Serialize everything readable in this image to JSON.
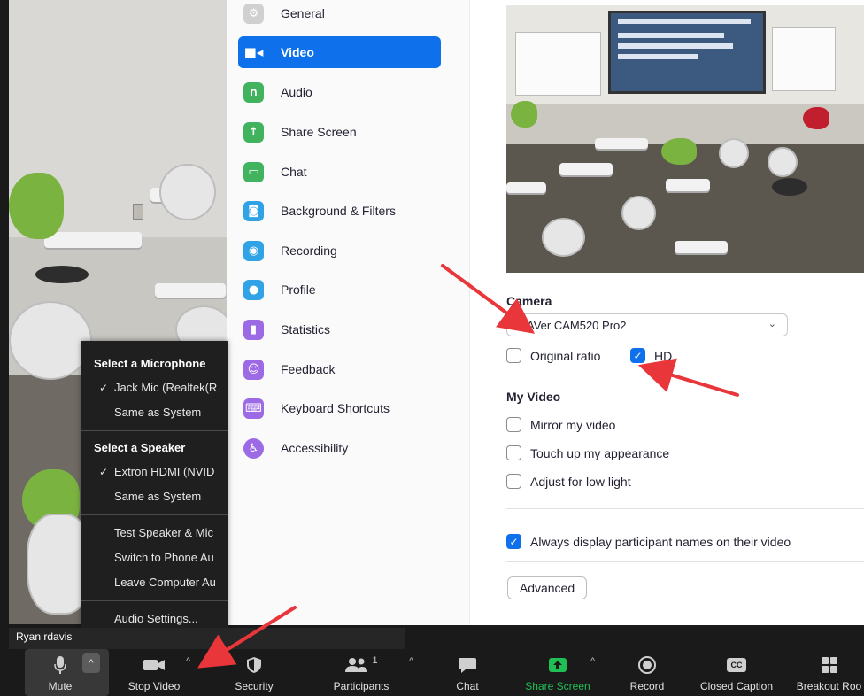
{
  "settings_nav": {
    "items": [
      {
        "label": "General",
        "icon": "gear-icon",
        "color": "#d0d0d0"
      },
      {
        "label": "Video",
        "icon": "video-camera-icon",
        "color": "#0e71eb",
        "active": true
      },
      {
        "label": "Audio",
        "icon": "headphones-icon",
        "color": "#41b35f"
      },
      {
        "label": "Share Screen",
        "icon": "share-screen-icon",
        "color": "#41b35f"
      },
      {
        "label": "Chat",
        "icon": "chat-bubble-icon",
        "color": "#41b35f"
      },
      {
        "label": "Background & Filters",
        "icon": "background-icon",
        "color": "#2fa3e6"
      },
      {
        "label": "Recording",
        "icon": "record-icon",
        "color": "#2fa3e6"
      },
      {
        "label": "Profile",
        "icon": "person-icon",
        "color": "#2fa3e6"
      },
      {
        "label": "Statistics",
        "icon": "bar-chart-icon",
        "color": "#9d6ae6"
      },
      {
        "label": "Feedback",
        "icon": "smiley-icon",
        "color": "#9d6ae6"
      },
      {
        "label": "Keyboard Shortcuts",
        "icon": "keyboard-icon",
        "color": "#9d6ae6"
      },
      {
        "label": "Accessibility",
        "icon": "accessibility-icon",
        "color": "#9d6ae6"
      }
    ]
  },
  "video_settings": {
    "camera_label": "Camera",
    "camera_value": "AVer CAM520 Pro2",
    "original_ratio_label": "Original ratio",
    "original_ratio_checked": false,
    "hd_label": "HD",
    "hd_checked": true,
    "my_video_label": "My Video",
    "mirror_label": "Mirror my video",
    "touch_up_label": "Touch up my appearance",
    "low_light_label": "Adjust for low light",
    "always_display_label": "Always display participant names on their video",
    "advanced_label": "Advanced"
  },
  "audio_menu": {
    "mic_title": "Select a Microphone",
    "mic_items": [
      "Jack Mic (Realtek(R",
      "Same as System"
    ],
    "speaker_title": "Select a Speaker",
    "speaker_items": [
      "Extron HDMI (NVID",
      "Same as System"
    ],
    "actions": [
      "Test Speaker & Mic",
      "Switch to Phone Au",
      "Leave Computer Au"
    ],
    "settings": "Audio Settings..."
  },
  "name_tag": "Ryan rdavis",
  "toolbar": {
    "mute": "Mute",
    "stop_video": "Stop Video",
    "security": "Security",
    "participants": "Participants",
    "participants_count": "1",
    "chat": "Chat",
    "share_screen": "Share Screen",
    "record": "Record",
    "closed_caption": "Closed Caption",
    "closed_caption_badge": "CC",
    "breakout": "Breakout Roo"
  },
  "colors": {
    "accent": "#0e71eb",
    "share_green": "#20bf55",
    "annotation_red": "#e8363a"
  }
}
